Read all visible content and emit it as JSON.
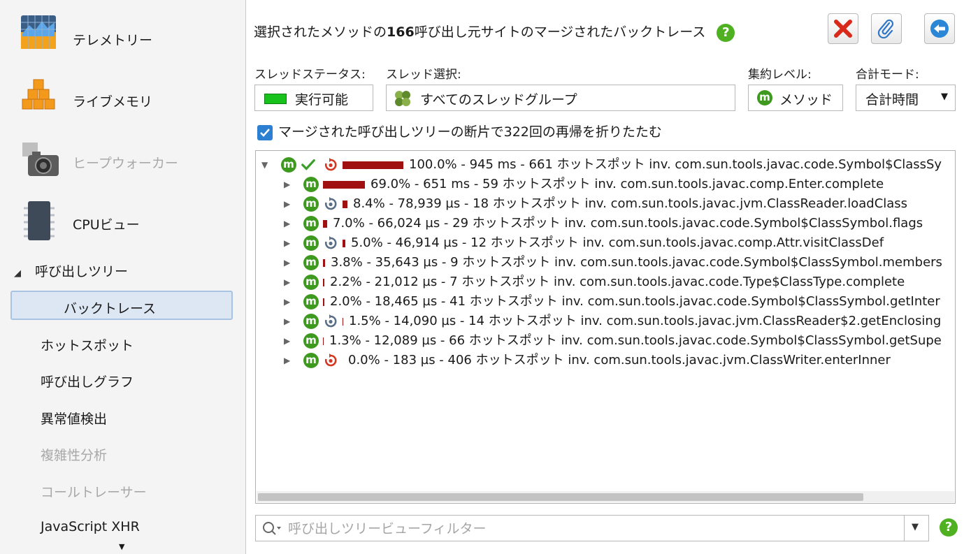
{
  "sidebar": {
    "telemetry": "テレメトリー",
    "live_memory": "ライブメモリ",
    "heap_walker": "ヒープウォーカー",
    "cpu_views": "CPUビュー",
    "call_tree_section": "呼び出しツリー",
    "items": [
      {
        "label": "バックトレース"
      },
      {
        "label": "ホットスポット"
      },
      {
        "label": "呼び出しグラフ"
      },
      {
        "label": "異常値検出"
      },
      {
        "label": "複雑性分析"
      },
      {
        "label": "コールトレーサー"
      },
      {
        "label": "JavaScript XHR"
      }
    ]
  },
  "header": {
    "title_prefix": "選択されたメソッドの",
    "title_count": "166",
    "title_suffix": "呼び出し元サイトのマージされたバックトレース"
  },
  "controls": {
    "thread_status_label": "スレッドステータス:",
    "thread_status_value": "実行可能",
    "thread_select_label": "スレッド選択:",
    "thread_select_value": "すべてのスレッドグループ",
    "aggregation_label": "集約レベル:",
    "aggregation_value": "メソッド",
    "aggregation_icon_letter": "m",
    "total_mode_label": "合計モード:",
    "total_mode_value": "合計時間",
    "merge_checkbox_label": "マージされた呼び出しツリーの断片で322回の再帰を折りたたむ",
    "merge_checked": true
  },
  "tree": {
    "rows": [
      {
        "text": "100.0% - 945 ms - 661 ホットスポット inv. com.sun.tools.javac.code.Symbol$ClassSy",
        "percent": 100.0,
        "icon": "recursion-icon",
        "expanded": true
      },
      {
        "text": "69.0% - 651 ms - 59 ホットスポット inv. com.sun.tools.javac.comp.Enter.complete",
        "percent": 69.0,
        "icon": "none"
      },
      {
        "text": "8.4% - 78,939 µs - 18 ホットスポット inv. com.sun.tools.javac.jvm.ClassReader.loadClass",
        "percent": 8.4,
        "icon": "recursion-gray-icon"
      },
      {
        "text": "7.0% - 66,024 µs - 29 ホットスポット inv. com.sun.tools.javac.code.Symbol$ClassSymbol.flags",
        "percent": 7.0,
        "icon": "none"
      },
      {
        "text": "5.0% - 46,914 µs - 12 ホットスポット inv. com.sun.tools.javac.comp.Attr.visitClassDef",
        "percent": 5.0,
        "icon": "recursion-gray-icon"
      },
      {
        "text": "3.8% - 35,643 µs - 9 ホットスポット inv. com.sun.tools.javac.code.Symbol$ClassSymbol.members",
        "percent": 3.8,
        "icon": "none"
      },
      {
        "text": "2.2% - 21,012 µs - 7 ホットスポット inv. com.sun.tools.javac.code.Type$ClassType.complete",
        "percent": 2.2,
        "icon": "none"
      },
      {
        "text": "2.0% - 18,465 µs - 41 ホットスポット inv. com.sun.tools.javac.code.Symbol$ClassSymbol.getInter",
        "percent": 2.0,
        "icon": "none"
      },
      {
        "text": "1.5% - 14,090 µs - 14 ホットスポット inv. com.sun.tools.javac.jvm.ClassReader$2.getEnclosing",
        "percent": 1.5,
        "icon": "recursion-gray-icon"
      },
      {
        "text": "1.3% - 12,089 µs - 66 ホットスポット inv. com.sun.tools.javac.code.Symbol$ClassSymbol.getSupe",
        "percent": 1.3,
        "icon": "none"
      },
      {
        "text": "0.0% - 183 µs - 406 ホットスポット inv. com.sun.tools.javac.jvm.ClassWriter.enterInner",
        "percent": 0.0,
        "icon": "recursion-icon"
      }
    ]
  },
  "filter": {
    "placeholder": "呼び出しツリービューフィルター"
  },
  "colors": {
    "bar": "#a11010",
    "method_icon": "#3e9a1e",
    "help_icon": "#4fb021",
    "selection_bg": "#dde7f3"
  }
}
